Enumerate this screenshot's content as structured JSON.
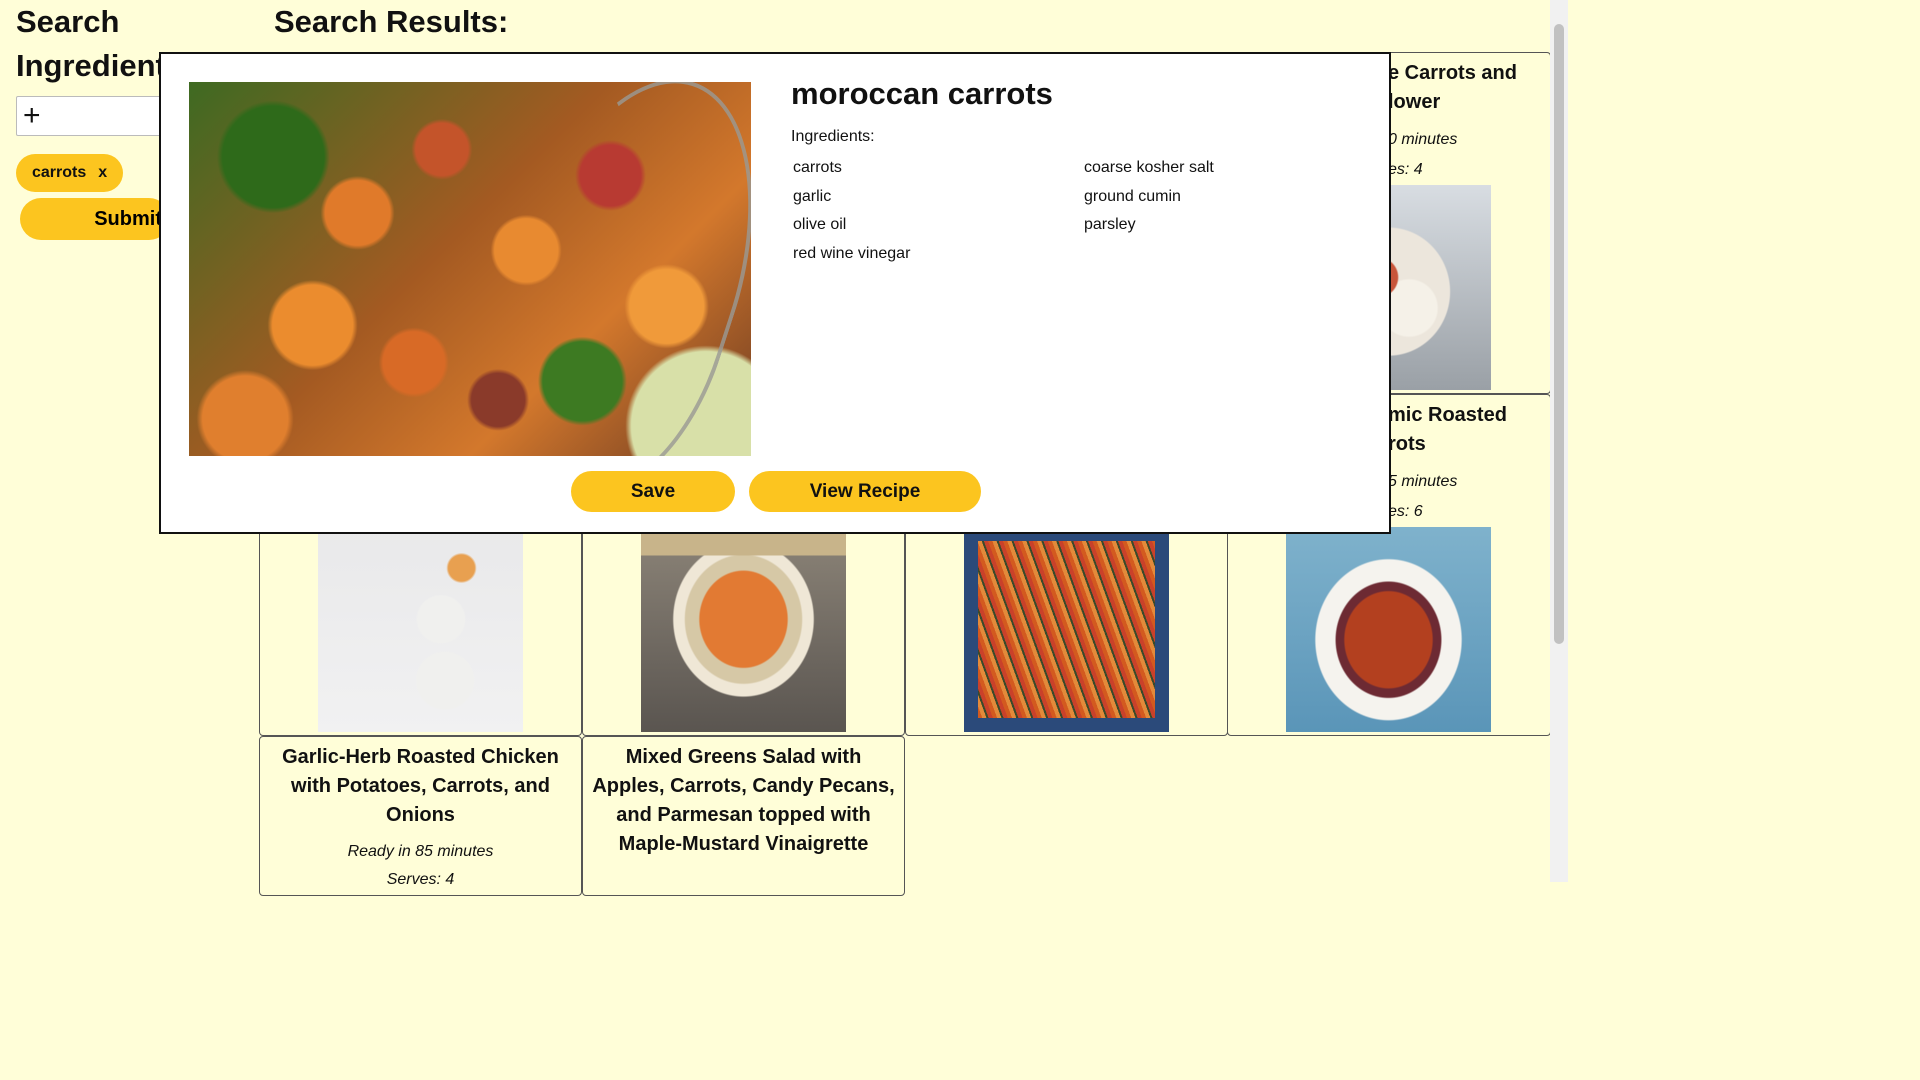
{
  "sidebar": {
    "heading": "Search Ingredients",
    "add_symbol": "+",
    "chips": [
      {
        "label": "carrots",
        "remove": "x"
      }
    ],
    "submit_label": "Submit"
  },
  "results": {
    "heading": "Search Results:",
    "cards": [
      {
        "title": "Garlic-Herb Roasted Chicken with Potatoes, Carrots, and Onions",
        "ready": "Ready in 85 minutes",
        "serves": "Serves: 4"
      },
      {
        "title": "Mixed Greens Salad with Apples, Carrots, Candy Pecans, and Parmesan topped with Maple-Mustard Vinaigrette"
      },
      {
        "title_partial": "e Carrots and",
        "title_partial2": "lower",
        "ready_partial": "0 minutes",
        "serves_partial": "es: 4"
      },
      {
        "title_partial": "mic Roasted",
        "title_partial2": "rots",
        "ready_partial": "5 minutes",
        "serves_partial": "es: 6"
      }
    ]
  },
  "modal": {
    "title": "moroccan carrots",
    "ingredients_label": "Ingredients:",
    "ingredients_col1": [
      "carrots",
      "garlic",
      "olive oil",
      "red wine vinegar"
    ],
    "ingredients_col2": [
      "coarse kosher salt",
      "ground cumin",
      "parsley"
    ],
    "save_label": "Save",
    "view_label": "View Recipe"
  },
  "colors": {
    "background": "#fffed8",
    "accent": "#fcc51f"
  }
}
